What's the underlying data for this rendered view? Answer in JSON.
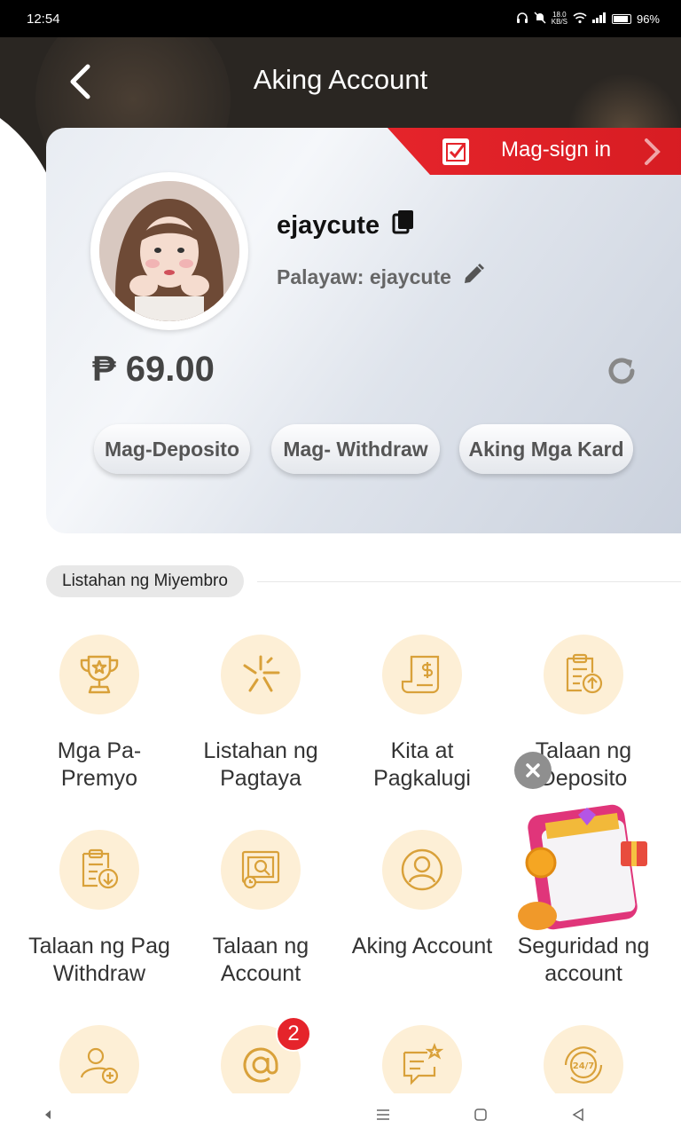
{
  "status_bar": {
    "time": "12:54",
    "net_speed_top": "18.0",
    "net_speed_bottom": "KB/S",
    "battery": "96%"
  },
  "header": {
    "title": "Aking Account"
  },
  "signin": {
    "label": "Mag-sign in"
  },
  "profile": {
    "username": "ejaycute",
    "nickname": "Palayaw: ejaycute",
    "balance": "₱ 69.00"
  },
  "actions": [
    {
      "label": "Mag-Deposito"
    },
    {
      "label": "Mag- Withdraw"
    },
    {
      "label": "Aking Mga Kard"
    }
  ],
  "section": {
    "title": "Listahan ng Miyembro"
  },
  "menu": [
    {
      "label": "Mga Pa-\nPremyo",
      "icon": "trophy-icon"
    },
    {
      "label": "Listahan ng\nPagtaya",
      "icon": "burst-icon"
    },
    {
      "label": "Kita at\nPagkalugi",
      "icon": "receipt-icon"
    },
    {
      "label": "Talaan ng\nDeposito",
      "icon": "clipboard-upload-icon"
    },
    {
      "label": "Talaan ng Pag\nWithdraw",
      "icon": "clipboard-download-icon"
    },
    {
      "label": "Talaan ng\nAccount",
      "icon": "ledger-search-icon"
    },
    {
      "label": "Aking Account",
      "icon": "user-icon"
    },
    {
      "label": "Seguridad ng\naccount",
      "icon": "shield-icon"
    },
    {
      "label": "",
      "icon": "add-user-icon"
    },
    {
      "label": "",
      "icon": "at-sign-icon",
      "badge": "2"
    },
    {
      "label": "",
      "icon": "message-star-icon"
    },
    {
      "label": "",
      "icon": "support-24-7-icon"
    }
  ],
  "colors": {
    "accent_red": "#e5242b",
    "icon_gold": "#d9a13a",
    "icon_bg": "#fdefd6",
    "header_dark": "#2a2622"
  }
}
